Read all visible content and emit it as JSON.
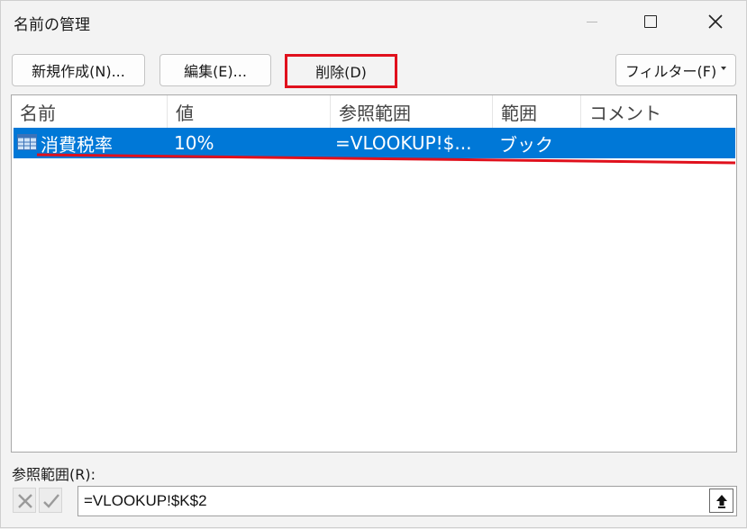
{
  "window": {
    "title": "名前の管理"
  },
  "toolbar": {
    "new_label": "新規作成(N)...",
    "edit_label": "編集(E)...",
    "delete_label": "削除(D)",
    "filter_label": "フィルター(F)"
  },
  "list": {
    "columns": [
      "名前",
      "値",
      "参照範囲",
      "範囲",
      "コメント"
    ],
    "rows": [
      {
        "name": "消費税率",
        "value": "10%",
        "refers_to": "=VLOOKUP!$...",
        "scope": "ブック",
        "comment": "",
        "selected": true
      }
    ]
  },
  "refers_to": {
    "label": "参照範囲(R):",
    "value": "=VLOOKUP!$K$2"
  },
  "colors": {
    "selection": "#0078d7",
    "highlight_red": "#e0101c"
  },
  "icons": {
    "cancel": "x-icon",
    "confirm": "checkmark-icon",
    "collapse": "arrow-up-icon",
    "row": "table-name-icon"
  }
}
